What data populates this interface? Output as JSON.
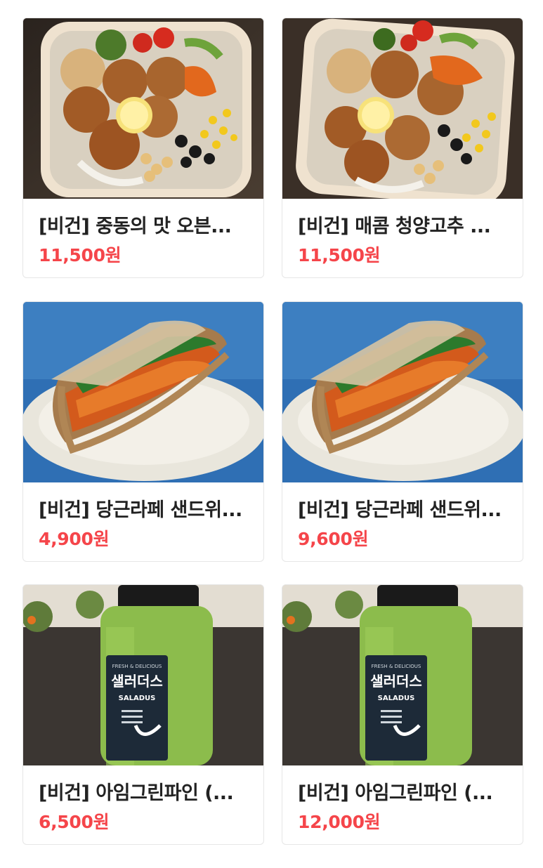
{
  "products": [
    {
      "name": "[비건] 중동의 맛 오븐...",
      "price": "11,500원",
      "image": "falafel-bowl"
    },
    {
      "name": "[비건] 매콤 청양고추 ...",
      "price": "11,500원",
      "image": "falafel-bowl"
    },
    {
      "name": "[비건] 당근라페 샌드위...",
      "price": "4,900원",
      "image": "carrot-sandwich"
    },
    {
      "name": "[비건] 당근라페 샌드위...",
      "price": "9,600원",
      "image": "carrot-sandwich"
    },
    {
      "name": "[비건] 아임그린파인 (...",
      "price": "6,500원",
      "image": "green-juice-bottle"
    },
    {
      "name": "[비건] 아임그린파인 (...",
      "price": "12,000원",
      "image": "green-juice-bottle"
    }
  ],
  "brand": {
    "label_top": "FRESH & DELICIOUS",
    "label_ko": "샐러더스",
    "label_en": "SALADUS"
  },
  "colors": {
    "price": "#f5454a",
    "text": "#222222",
    "border": "#e6e6e6"
  }
}
